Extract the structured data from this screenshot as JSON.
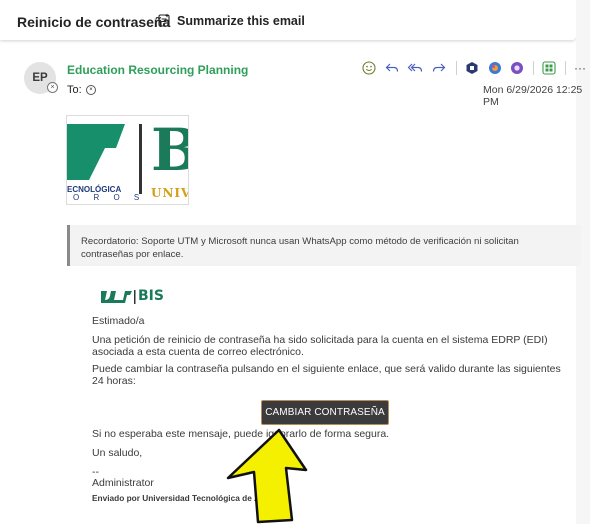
{
  "subject": {
    "title": "Reinicio de contraseña",
    "summarize_label": "Summarize this email"
  },
  "header": {
    "avatar_initials": "EP",
    "sender_name": "Education Resourcing Planning",
    "to_label": "To:",
    "date": "Mon 6/29/2026 12:25 PM",
    "toolbar_icons": [
      "smiley-icon",
      "reply-icon",
      "reply-all-icon",
      "forward-icon",
      "teams-icon",
      "copilot-icon",
      "loop-icon",
      "apps-icon",
      "more-icon"
    ],
    "more_glyph": "···"
  },
  "logo": {
    "left_line1": "ECNOLÓGICA",
    "left_line2": "O R O S",
    "right_letter": "B",
    "right_text": "UNIVE"
  },
  "reminder": {
    "text": "Recordatorio: Soporte UTM y Microsoft nunca usan WhatsApp como método de verificación ni solicitan contraseñas por enlace."
  },
  "body": {
    "brand_mark": "BIS",
    "greeting": "Estimado/a",
    "paragraph1": "Una petición de reinicio de contraseña ha sido solicitada para la cuenta en el sistema EDRP (EDI) asociada a esta cuenta de correo electrónico.",
    "paragraph2": "Puede cambiar la contraseña pulsando en el siguiente enlace, que será valido durante las siguientes 24 horas:",
    "cta_label": "CAMBIAR CONTRASEÑA",
    "paragraph3": "Si no esperaba este mensaje, puede ignorarlo de forma segura.",
    "closing": "Un saludo,",
    "signature_dash": "--",
    "signature_name": "Administrator",
    "sent_by": "Enviado por Universidad Tecnológica de Zamoros"
  },
  "colors": {
    "sender_green": "#2f9e5b",
    "cta_background": "#3b3b3b",
    "arrow_yellow": "#f5f000"
  }
}
